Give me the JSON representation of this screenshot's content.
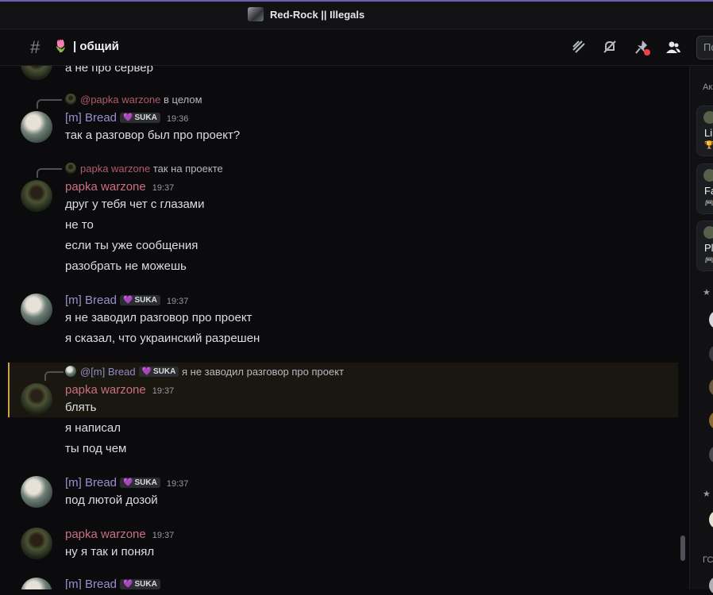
{
  "window": {
    "title": "Red-Rock || Illegals"
  },
  "header": {
    "channel_emoji": "🌷",
    "channel_name": "| общий",
    "search_placeholder": "По"
  },
  "messages": {
    "top_partial": "а не про сервер",
    "m1": {
      "reply_user": "@papka warzone",
      "reply_text": "в целом",
      "author": "[m] Bread",
      "tag": "SUKA",
      "time": "19:36",
      "lines": [
        "так а разговор был про проект?"
      ]
    },
    "m2": {
      "reply_user": "papka warzone",
      "reply_text": "так на проекте",
      "author": "papka warzone",
      "time": "19:37",
      "lines": [
        "друг у тебя чет с глазами",
        "не то",
        "если ты уже сообщения",
        "разобрать не можешь"
      ]
    },
    "m3": {
      "author": "[m] Bread",
      "tag": "SUKA",
      "time": "19:37",
      "lines": [
        "я не заводил разговор про проект",
        "я сказал, что украинский разрешен"
      ]
    },
    "m4": {
      "reply_user": "@[m] Bread",
      "reply_tag": "SUKA",
      "reply_text": "я не заводил разговор про проект",
      "author": "papka warzone",
      "time": "19:37",
      "lines": [
        "блять",
        "я написал",
        "ты под чем"
      ]
    },
    "m5": {
      "author": "[m] Bread",
      "tag": "SUKA",
      "time": "19:37",
      "lines": [
        "под лютой дозой"
      ]
    },
    "m6": {
      "author": "papka warzone",
      "time": "19:37",
      "lines": [
        "ну я так и понял"
      ]
    },
    "m7_partial": {
      "author": "[m] Bread",
      "tag": "SUKA"
    }
  },
  "members": {
    "section1": "Ак",
    "cards": [
      {
        "name": "Li",
        "icon": "🏆"
      },
      {
        "name": "Fa",
        "icon": "🎮"
      },
      {
        "name": "Pl",
        "icon": "🎮"
      }
    ],
    "section2": "★",
    "section3": "★",
    "section4": "ГС"
  },
  "colors": {
    "papka": "#c96f82",
    "bread": "#9a8fd0",
    "highlight_border": "#c9a24a",
    "background": "#0b0b0e"
  }
}
